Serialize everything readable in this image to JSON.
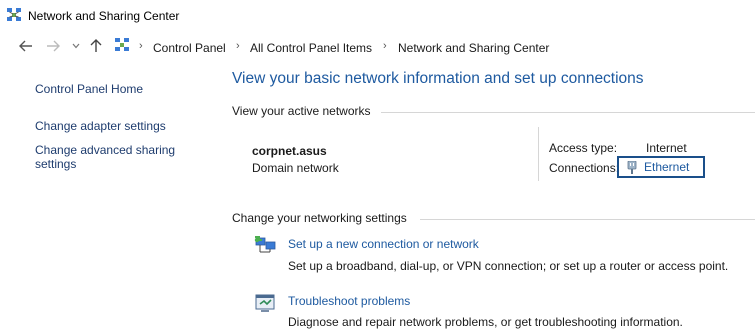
{
  "window": {
    "title": "Network and Sharing Center",
    "icon": "network-center-icon"
  },
  "address_bar": {
    "crumbs": [
      "Control Panel",
      "All Control Panel Items",
      "Network and Sharing Center"
    ],
    "back_icon": "arrow-left-icon",
    "forward_icon": "arrow-right-icon",
    "recent_icon": "chevron-down-icon",
    "up_icon": "arrow-up-icon"
  },
  "sidebar": {
    "home": "Control Panel Home",
    "items": [
      {
        "label": "Change adapter settings"
      },
      {
        "label_line1": "Change advanced sharing",
        "label_line2": "settings"
      }
    ]
  },
  "main": {
    "title": "View your basic network information and set up connections",
    "active_networks_heading": "View your active networks",
    "network": {
      "name": "corpnet.asus",
      "category": "Domain network",
      "access_type_label": "Access type:",
      "access_type_value": "Internet",
      "connections_label": "Connections:",
      "connection_link": "Ethernet",
      "connection_icon": "ethernet-plug-icon"
    },
    "change_settings_heading": "Change your networking settings",
    "actions": [
      {
        "icon": "new-connection-icon",
        "link": "Set up a new connection or network",
        "description": "Set up a broadband, dial-up, or VPN connection; or set up a router or access point."
      },
      {
        "icon": "troubleshoot-icon",
        "link": "Troubleshoot problems",
        "description": "Diagnose and repair network problems, or get troubleshooting information."
      }
    ]
  },
  "colors": {
    "link_blue": "#1e5aa0",
    "nav_link": "#1e3c6e",
    "highlight_border": "#1a4f8a",
    "divider": "#d6d6d6"
  }
}
